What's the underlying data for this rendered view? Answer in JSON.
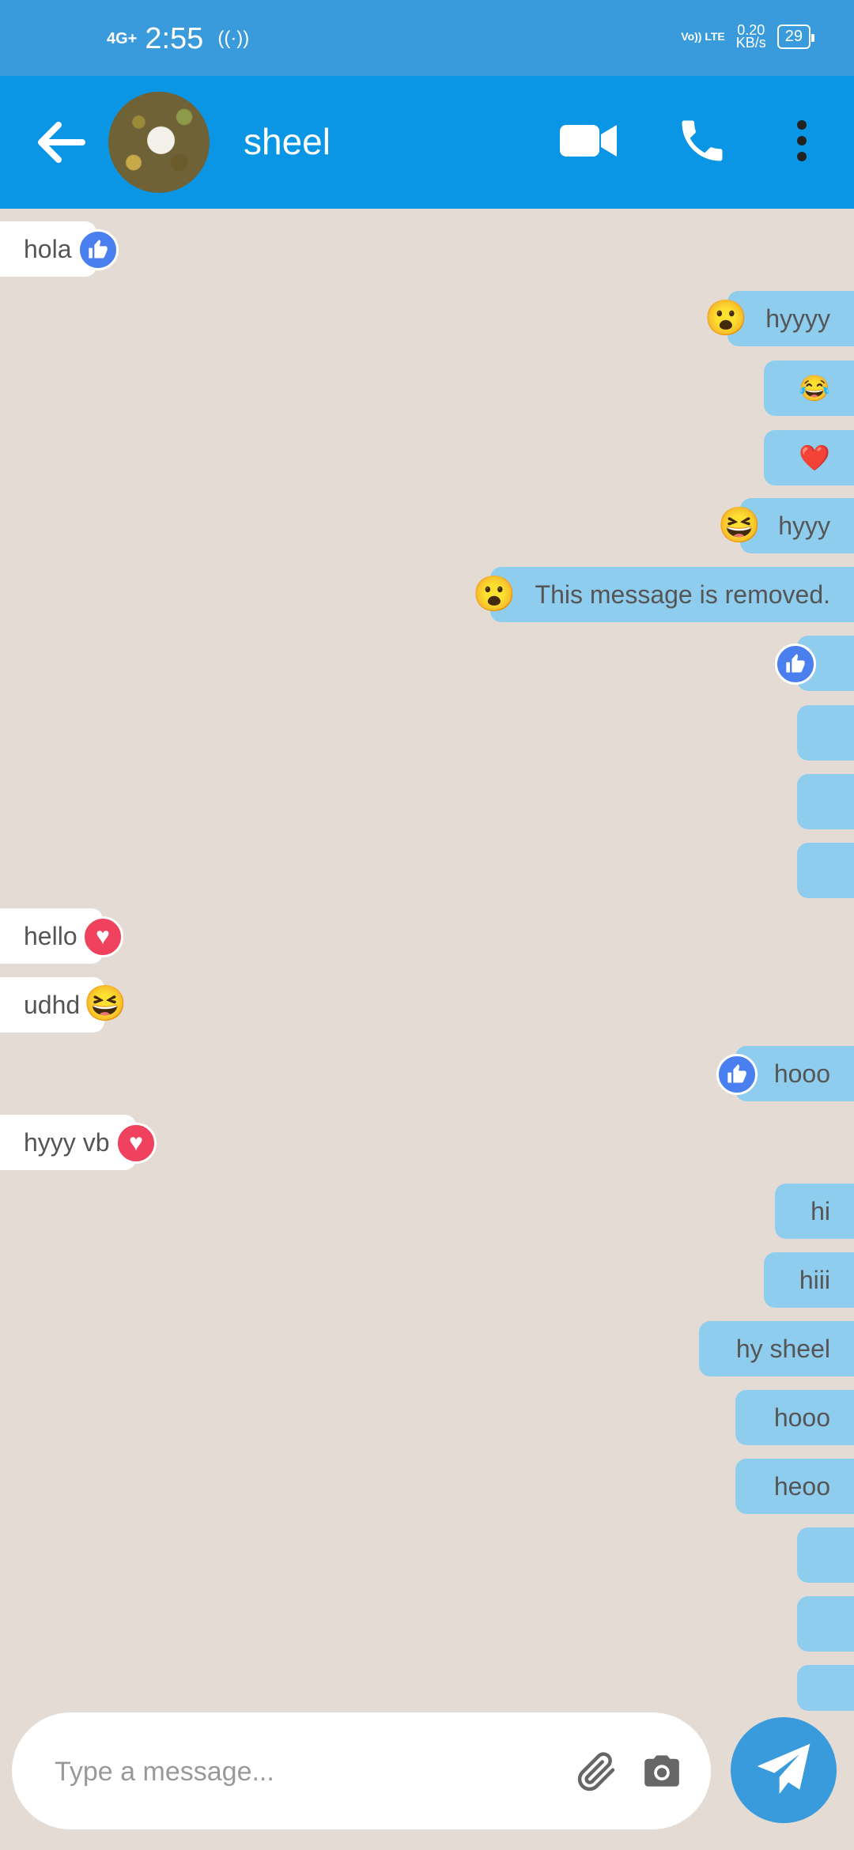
{
  "status_bar": {
    "network": "4G+",
    "time": "2:55",
    "hotspot": "((·))",
    "volte": "Vo)) LTE",
    "speed_value": "0.20",
    "speed_unit": "KB/s",
    "battery": "29"
  },
  "header": {
    "contact_name": "sheel",
    "icons": [
      "back-arrow-icon",
      "video-call-icon",
      "phone-icon",
      "more-vert-icon"
    ]
  },
  "messages": [
    {
      "dir": "in",
      "text": "hola",
      "reaction": "like"
    },
    {
      "dir": "out",
      "text": "hyyyy",
      "reaction": "😮"
    },
    {
      "dir": "out",
      "text": "😂",
      "reaction": ""
    },
    {
      "dir": "out",
      "text": "❤️",
      "reaction": ""
    },
    {
      "dir": "out",
      "text": "hyyy",
      "reaction": "😆"
    },
    {
      "dir": "out",
      "text": "This message is removed.",
      "reaction": "😮"
    },
    {
      "dir": "out",
      "text": "",
      "reaction": "like"
    },
    {
      "dir": "out",
      "text": "",
      "reaction": ""
    },
    {
      "dir": "out",
      "text": "",
      "reaction": ""
    },
    {
      "dir": "out",
      "text": "",
      "reaction": ""
    },
    {
      "dir": "in",
      "text": "hello",
      "reaction": "heart"
    },
    {
      "dir": "in",
      "text": "udhd",
      "reaction": "😆"
    },
    {
      "dir": "out",
      "text": "hooo",
      "reaction": "like"
    },
    {
      "dir": "in",
      "text": "hyyy vb",
      "reaction": "heart"
    },
    {
      "dir": "out",
      "text": "hi",
      "reaction": ""
    },
    {
      "dir": "out",
      "text": "hiii",
      "reaction": ""
    },
    {
      "dir": "out",
      "text": "hy sheel",
      "reaction": ""
    },
    {
      "dir": "out",
      "text": "hooo",
      "reaction": ""
    },
    {
      "dir": "out",
      "text": "heoo",
      "reaction": ""
    },
    {
      "dir": "out",
      "text": "",
      "reaction": ""
    },
    {
      "dir": "out",
      "text": "",
      "reaction": ""
    },
    {
      "dir": "out",
      "text": "",
      "reaction": ""
    }
  ],
  "composer": {
    "placeholder": "Type a message...",
    "icons": [
      "attach-icon",
      "camera-icon",
      "send-icon"
    ]
  },
  "colors": {
    "status_bar": "#3a9bdc",
    "header": "#0a96e4",
    "outgoing_bubble": "#8fcdef",
    "incoming_bubble": "#ffffff",
    "chat_background": "#e4dcd4"
  }
}
